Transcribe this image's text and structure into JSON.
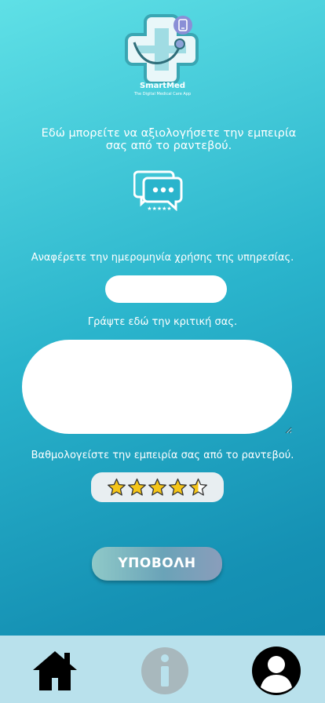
{
  "logo": {
    "title": "SmartMed",
    "subtitle": "The Digital Medical Care App",
    "icon": "medical-cross-stethoscope-logo"
  },
  "intro_text": "Εδώ μπορείτε να αξιολογήσετε την εμπειρία σας από το ραντεβού.",
  "review_icon": "chat-bubbles-rating-icon",
  "date_section": {
    "label": "Αναφέρετε την ημερομηνία χρήσης της υπηρεσίας.",
    "value": "",
    "placeholder": ""
  },
  "review_section": {
    "label": "Γράψτε εδώ την κριτική σας.",
    "value": "",
    "placeholder": ""
  },
  "rating_section": {
    "label": "Βαθμολογείστε την εμπειρία σας από το ραντεβού.",
    "rating": 4.5,
    "max": 5
  },
  "submit_label": "ΥΠΟΒΟΛΗ",
  "bottom_nav": [
    {
      "icon": "home-icon"
    },
    {
      "icon": "info-icon"
    },
    {
      "icon": "user-profile-icon"
    }
  ],
  "colors": {
    "star": "#f5c518",
    "star_outline": "#333333",
    "nav_bg": "#b9e1ec",
    "info_icon": "#a8b8bd"
  }
}
